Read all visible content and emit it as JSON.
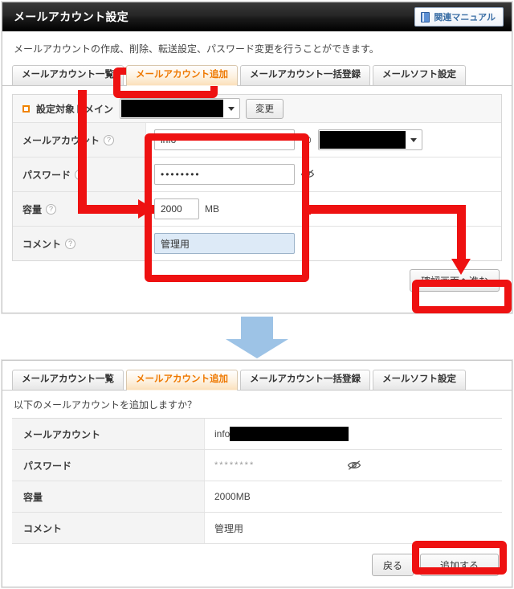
{
  "window": {
    "title": "メールアカウント設定",
    "manual_button": {
      "label": "関連マニュアル",
      "icon": "book-icon"
    }
  },
  "top_panel": {
    "intro": "メールアカウントの作成、削除、転送設定、パスワード変更を行うことができます。",
    "tabs": [
      {
        "label": "メールアカウント一覧",
        "active": false
      },
      {
        "label": "メールアカウント追加",
        "active": true
      },
      {
        "label": "メールアカウント一括登録",
        "active": false
      },
      {
        "label": "メールソフト設定",
        "active": false
      }
    ],
    "domain_row": {
      "label": "設定対象ドメイン",
      "selected_value": "",
      "change_button": "変更"
    },
    "fields": [
      {
        "label": "メールアカウント",
        "help": "?",
        "value": "info",
        "separator": "@",
        "domain_value": ""
      },
      {
        "label": "パスワード",
        "help": "?",
        "value": "••••••••",
        "toggle_icon": "eye-off-icon"
      },
      {
        "label": "容量",
        "help": "?",
        "value": "2000",
        "unit": "MB"
      },
      {
        "label": "コメント",
        "help": "?",
        "value": "管理用"
      }
    ],
    "submit_button": "確認画面へ進む"
  },
  "bottom_panel": {
    "tabs": [
      {
        "label": "メールアカウント一覧",
        "active": false
      },
      {
        "label": "メールアカウント追加",
        "active": true
      },
      {
        "label": "メールアカウント一括登録",
        "active": false
      },
      {
        "label": "メールソフト設定",
        "active": false
      }
    ],
    "question": "以下のメールアカウントを追加しますか？",
    "rows": [
      {
        "label": "メールアカウント",
        "value": "info",
        "redacted": true
      },
      {
        "label": "パスワード",
        "value": "********",
        "toggle_icon": "eye-off-icon"
      },
      {
        "label": "容量",
        "value": "2000MB"
      },
      {
        "label": "コメント",
        "value": "管理用"
      }
    ],
    "back_button": "戻る",
    "add_button": "追加する"
  },
  "annotations": {
    "highlight_color": "#ee1111",
    "transition_arrow_color": "#9dc3e6"
  }
}
